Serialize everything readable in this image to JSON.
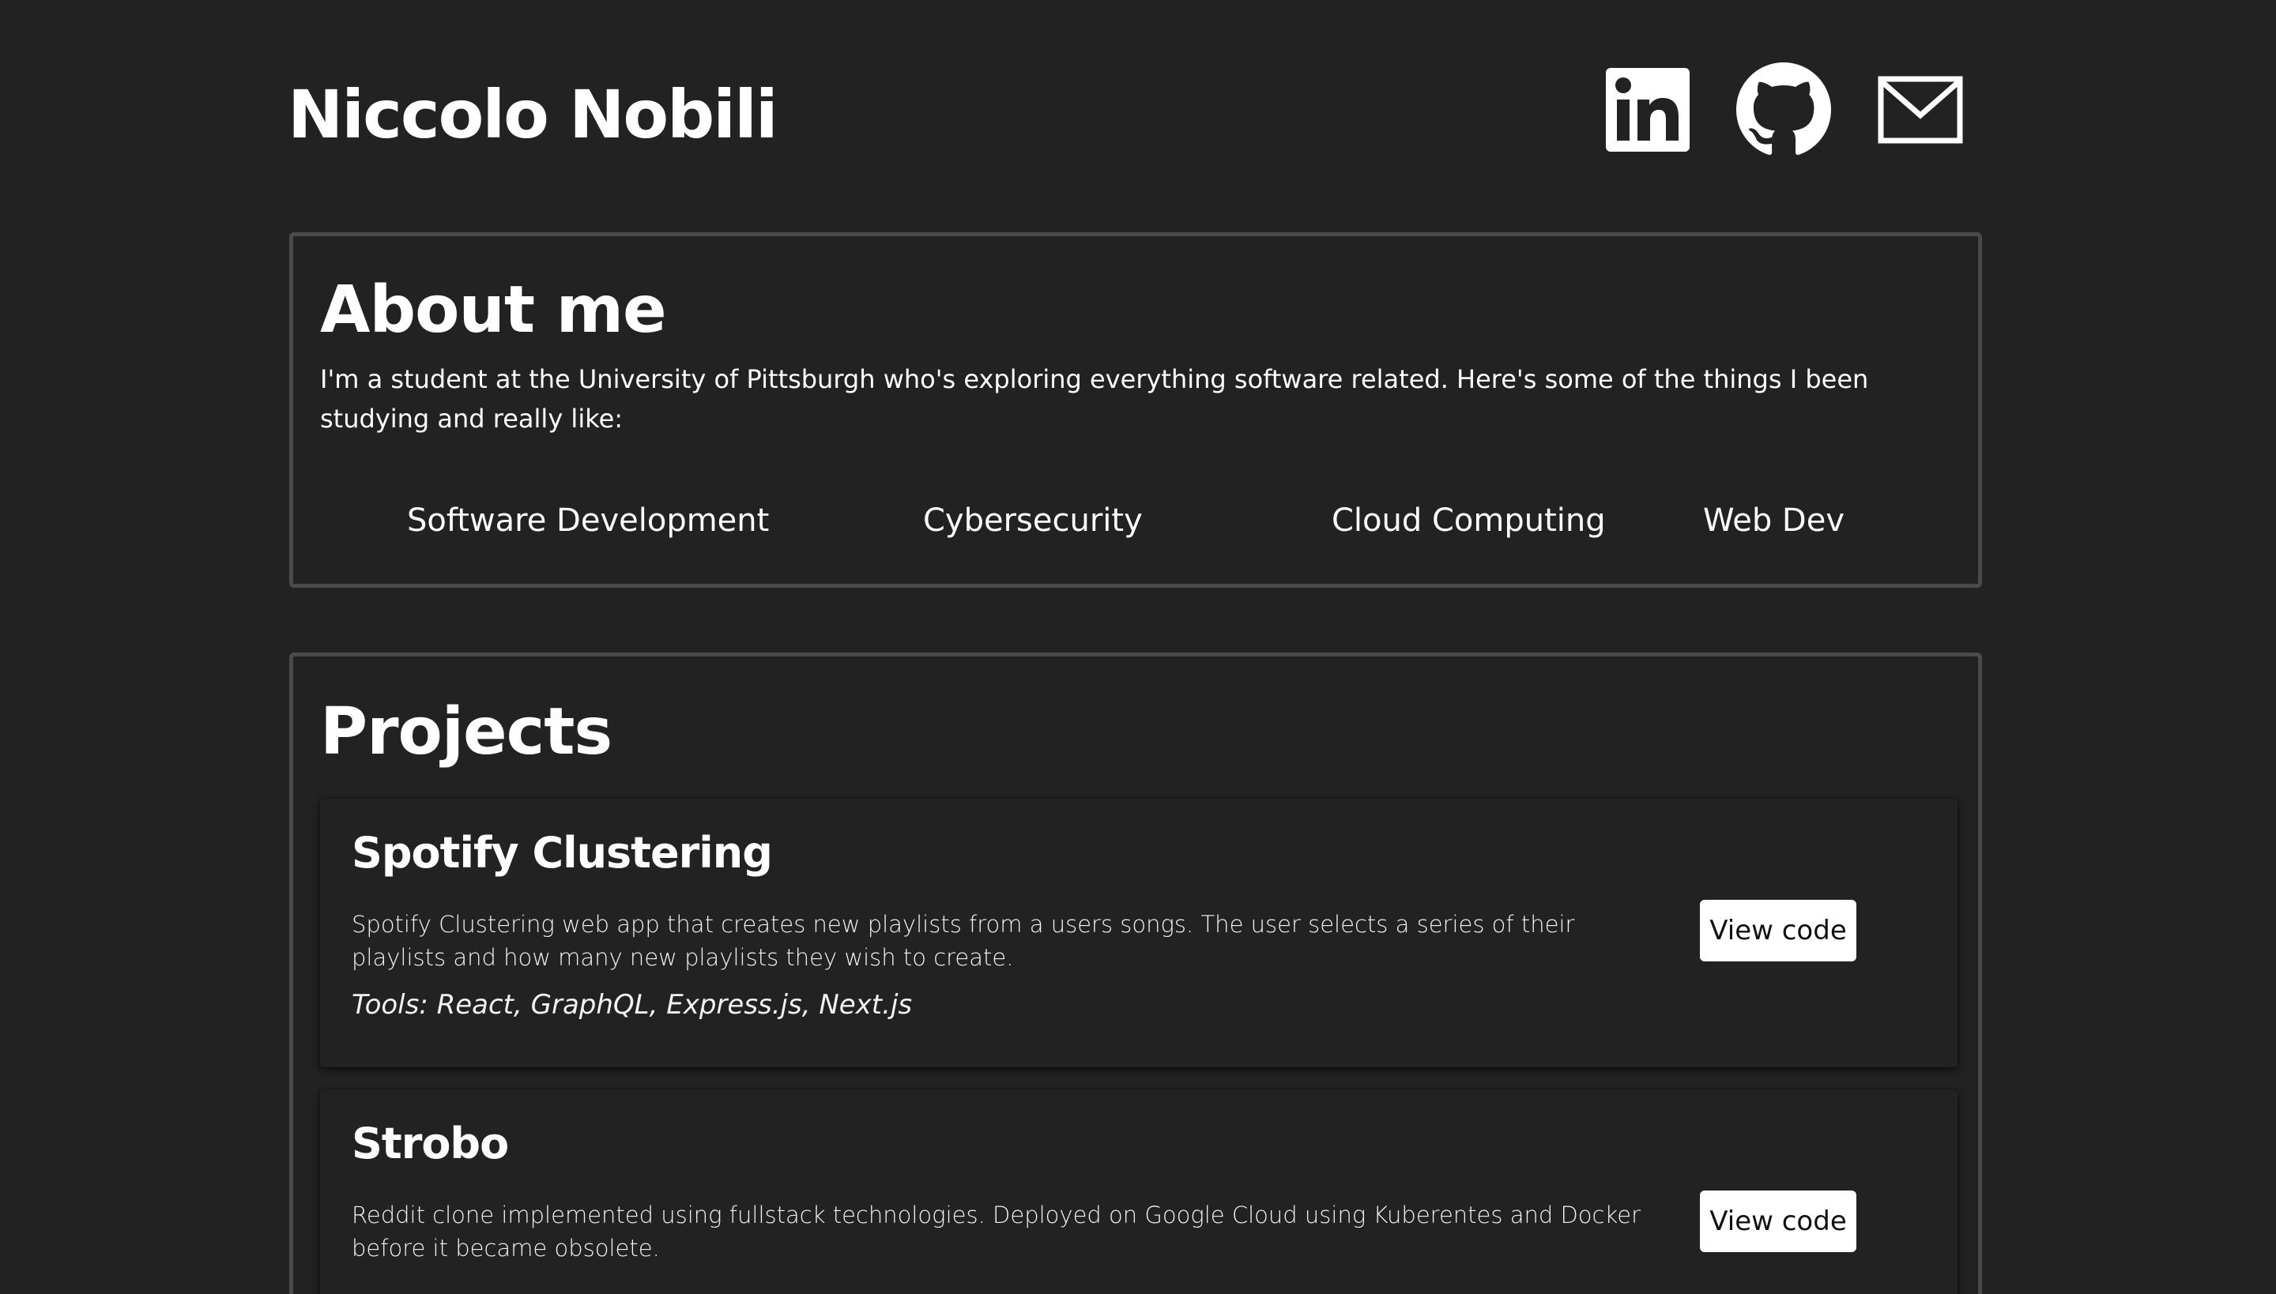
{
  "header": {
    "name": "Niccolo Nobili",
    "social": [
      {
        "icon": "linkedin-icon"
      },
      {
        "icon": "github-icon"
      },
      {
        "icon": "mail-icon"
      }
    ]
  },
  "about": {
    "heading": "About me",
    "text": "I'm a student at the University of Pittsburgh who's exploring everything software related. Here's some of the things I been studying and really like:",
    "interests": [
      "Software Development",
      "Cybersecurity",
      "Cloud Computing",
      "Web Dev"
    ]
  },
  "projects": {
    "heading": "Projects",
    "items": [
      {
        "title": "Spotify Clustering",
        "description": "Spotify Clustering web app that creates new playlists from a users songs. The user selects a series of their playlists and how many new playlists they wish to create.",
        "tools_label": "Tools",
        "tools": ": React, GraphQL, Express.js, Next.js",
        "button": "View code"
      },
      {
        "title": "Strobo",
        "description": "Reddit clone implemented using fullstack technologies. Deployed on Google Cloud using Kuberentes and Docker before it became obsolete.",
        "button": "View code"
      }
    ]
  },
  "colors": {
    "background": "#222222",
    "border": "#4a4a4a",
    "text": "#ffffff",
    "button_bg": "#ffffff",
    "button_text": "#111111"
  }
}
